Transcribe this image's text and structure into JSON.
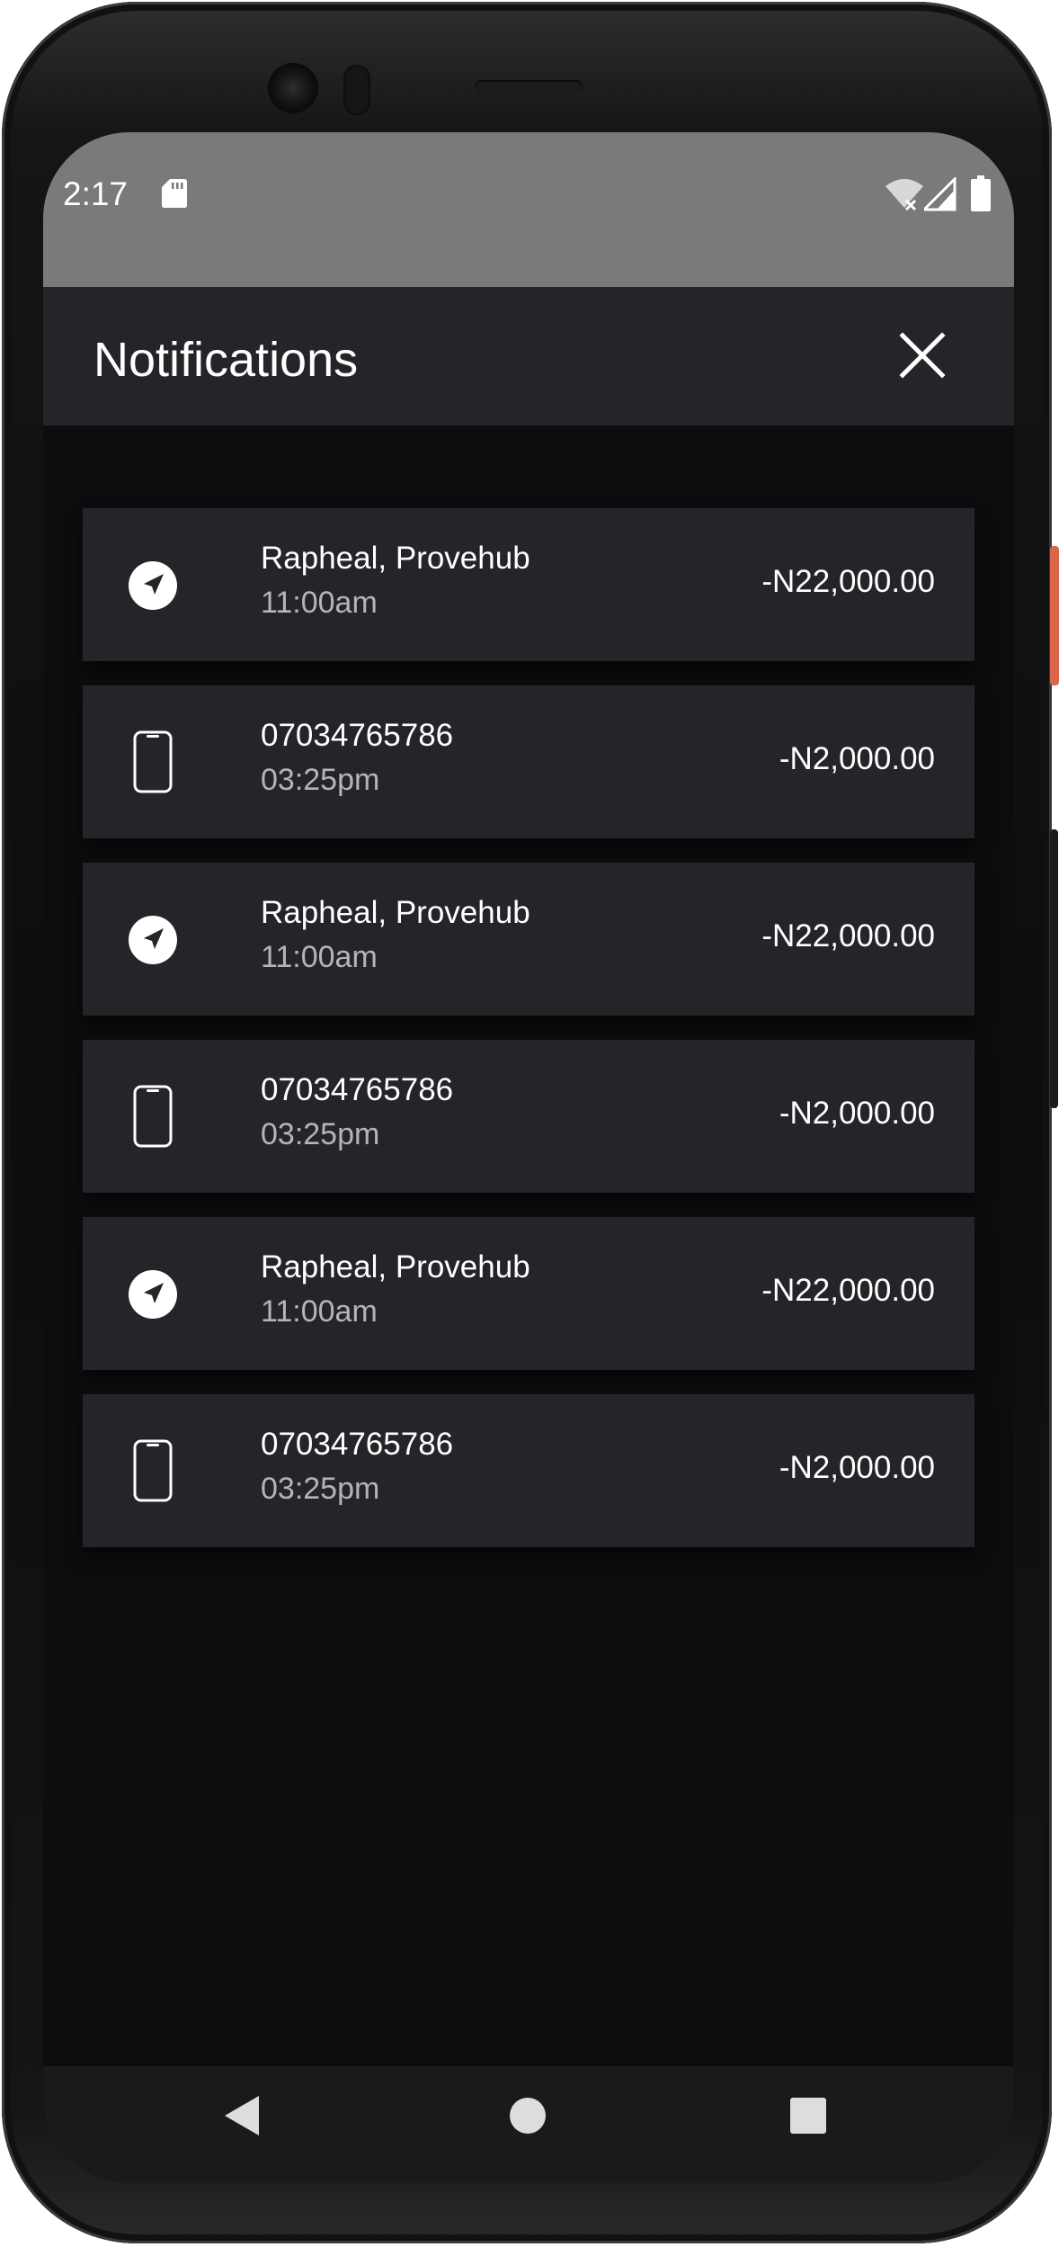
{
  "status_bar": {
    "time": "2:17",
    "icons": [
      "sd-card-icon",
      "wifi-off-icon",
      "cell-signal-icon",
      "battery-icon"
    ]
  },
  "app_bar": {
    "title": "Notifications",
    "close_icon": "close-icon"
  },
  "notifications": [
    {
      "icon": "navigation-arrow-icon",
      "title": "Rapheal, Provehub",
      "time": "11:00am",
      "amount": "-N22,000.00"
    },
    {
      "icon": "phone-icon",
      "title": "07034765786",
      "time": "03:25pm",
      "amount": "-N2,000.00"
    },
    {
      "icon": "navigation-arrow-icon",
      "title": "Rapheal, Provehub",
      "time": "11:00am",
      "amount": "-N22,000.00"
    },
    {
      "icon": "phone-icon",
      "title": "07034765786",
      "time": "03:25pm",
      "amount": "-N2,000.00"
    },
    {
      "icon": "navigation-arrow-icon",
      "title": "Rapheal, Provehub",
      "time": "11:00am",
      "amount": "-N22,000.00"
    },
    {
      "icon": "phone-icon",
      "title": "07034765786",
      "time": "03:25pm",
      "amount": "-N2,000.00"
    }
  ],
  "nav_bar": {
    "icons": [
      "back-icon",
      "home-icon",
      "recents-icon"
    ]
  },
  "colors": {
    "screen_background": "#0d0d0f",
    "card_background": "#242528",
    "status_bar": "#7a7a7a",
    "text_primary": "#ffffff",
    "text_secondary": "#b5b5b5",
    "power_button_accent": "#d9654a"
  }
}
